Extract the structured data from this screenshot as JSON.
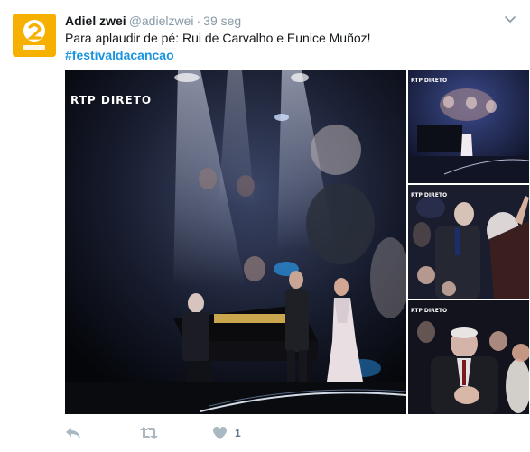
{
  "tweet": {
    "author_name": "Adiel zwei",
    "handle": "@adielzwei",
    "separator": "·",
    "timestamp": "39 seg",
    "text": "Para aplaudir de pé: Rui de Carvalho e Eunice Muñoz!",
    "hashtag": "#festivaldacancao"
  },
  "media": {
    "main_overlay": "RTP DIRETO",
    "thumb_overlay": "RTP DIRETO"
  },
  "actions": {
    "like_count": "1"
  },
  "colors": {
    "link": "#1b95e0",
    "muted": "#8899a6",
    "avatar_bg": "#f6b000"
  },
  "icons": {
    "avatar": "rtp2-logo",
    "caret": "chevron-down-icon",
    "reply": "reply-icon",
    "retweet": "retweet-icon",
    "like": "heart-icon"
  }
}
